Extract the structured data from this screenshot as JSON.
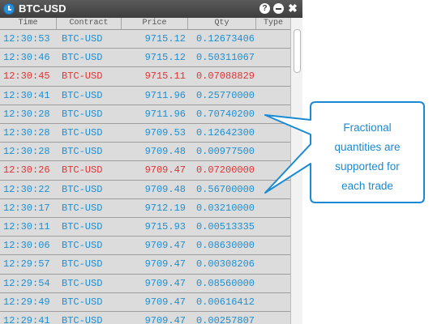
{
  "window": {
    "title": "BTC-USD",
    "help_symbol": "?",
    "close_symbol": "✖"
  },
  "columns": [
    "Time",
    "Contract",
    "Price",
    "Qty",
    "Type"
  ],
  "rows": [
    {
      "time": "12:30:53",
      "contract": "BTC-USD",
      "price": "9715.12",
      "qty": "0.12673406",
      "side": "buy"
    },
    {
      "time": "12:30:46",
      "contract": "BTC-USD",
      "price": "9715.12",
      "qty": "0.50311067",
      "side": "buy"
    },
    {
      "time": "12:30:45",
      "contract": "BTC-USD",
      "price": "9715.11",
      "qty": "0.07088829",
      "side": "sell"
    },
    {
      "time": "12:30:41",
      "contract": "BTC-USD",
      "price": "9711.96",
      "qty": "0.25770000",
      "side": "buy"
    },
    {
      "time": "12:30:28",
      "contract": "BTC-USD",
      "price": "9711.96",
      "qty": "0.70740200",
      "side": "buy"
    },
    {
      "time": "12:30:28",
      "contract": "BTC-USD",
      "price": "9709.53",
      "qty": "0.12642300",
      "side": "buy"
    },
    {
      "time": "12:30:28",
      "contract": "BTC-USD",
      "price": "9709.48",
      "qty": "0.00977500",
      "side": "buy"
    },
    {
      "time": "12:30:26",
      "contract": "BTC-USD",
      "price": "9709.47",
      "qty": "0.07200000",
      "side": "sell"
    },
    {
      "time": "12:30:22",
      "contract": "BTC-USD",
      "price": "9709.48",
      "qty": "0.56700000",
      "side": "buy"
    },
    {
      "time": "12:30:17",
      "contract": "BTC-USD",
      "price": "9712.19",
      "qty": "0.03210000",
      "side": "buy"
    },
    {
      "time": "12:30:11",
      "contract": "BTC-USD",
      "price": "9715.93",
      "qty": "0.00513335",
      "side": "buy"
    },
    {
      "time": "12:30:06",
      "contract": "BTC-USD",
      "price": "9709.47",
      "qty": "0.08630000",
      "side": "buy"
    },
    {
      "time": "12:29:57",
      "contract": "BTC-USD",
      "price": "9709.47",
      "qty": "0.00308206",
      "side": "buy"
    },
    {
      "time": "12:29:54",
      "contract": "BTC-USD",
      "price": "9709.47",
      "qty": "0.08560000",
      "side": "buy"
    },
    {
      "time": "12:29:49",
      "contract": "BTC-USD",
      "price": "9709.47",
      "qty": "0.00616412",
      "side": "buy"
    },
    {
      "time": "12:29:41",
      "contract": "BTC-USD",
      "price": "9709.47",
      "qty": "0.00257807",
      "side": "buy"
    }
  ],
  "colors": {
    "buy": "#1e8fd2",
    "sell": "#e03434",
    "callout_border": "#1a8ad3"
  },
  "callout": {
    "text": "Fractional quantities are supported for each trade"
  }
}
